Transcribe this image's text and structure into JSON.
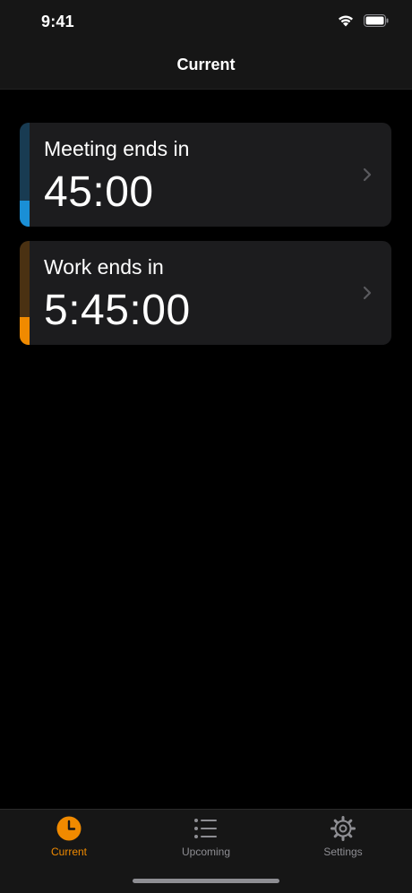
{
  "status_bar": {
    "time": "9:41",
    "icons": [
      "wifi-icon",
      "battery-icon"
    ]
  },
  "nav": {
    "title": "Current"
  },
  "timers": [
    {
      "label": "Meeting ends in",
      "time": "45:00",
      "color": "#1a8fd6",
      "track_color": "#183b52",
      "progress": 0.25,
      "icon": "chevron-right-icon"
    },
    {
      "label": "Work ends in",
      "time": "5:45:00",
      "color": "#f08a00",
      "track_color": "#4a3112",
      "progress": 0.27,
      "icon": "chevron-right-icon"
    }
  ],
  "tabs": [
    {
      "label": "Current",
      "icon": "clock-icon",
      "selected": true
    },
    {
      "label": "Upcoming",
      "icon": "list-icon",
      "selected": false
    },
    {
      "label": "Settings",
      "icon": "gear-icon",
      "selected": false
    }
  ],
  "colors": {
    "accent": "#f08a00",
    "inactive": "#8e8e93",
    "background": "#000000",
    "card": "#1c1c1e"
  }
}
